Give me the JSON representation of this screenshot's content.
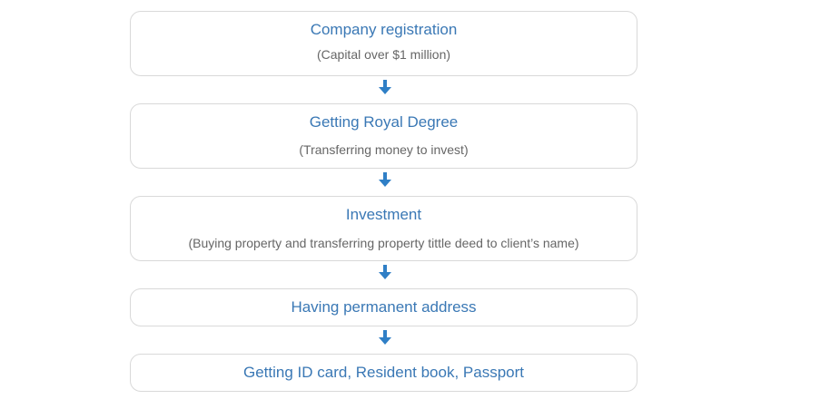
{
  "accent_color": "#2f7fc6",
  "title_color": "#3a78b5",
  "subtitle_color": "#666666",
  "steps": [
    {
      "title": "Company registration",
      "subtitle": "(Capital over $1 million)"
    },
    {
      "title": "Getting Royal Degree",
      "subtitle": "(Transferring money to invest)"
    },
    {
      "title": "Investment",
      "subtitle": "(Buying property and transferring property tittle deed to client’s name)"
    },
    {
      "title": "Having permanent address"
    },
    {
      "title": "Getting ID card, Resident book, Passport"
    }
  ],
  "connector_icon": "down-arrow-icon"
}
